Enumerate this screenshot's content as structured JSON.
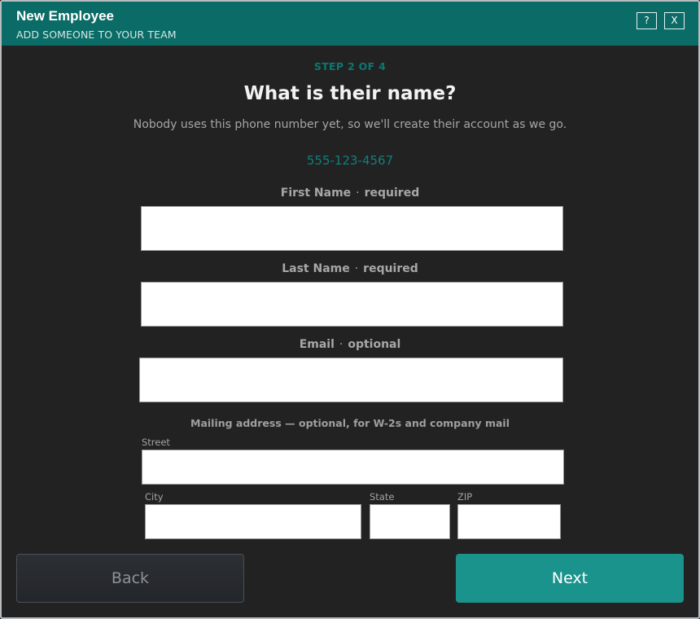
{
  "window": {
    "title": "New Employee",
    "subtitle": "ADD SOMEONE TO YOUR TEAM",
    "help_label": "?",
    "close_label": "X"
  },
  "step": {
    "text": "STEP 2 OF 4"
  },
  "heading": "What is their name?",
  "description": "Nobody uses this phone number yet, so we'll create their account as we go.",
  "phone_number": "555-123-4567",
  "fields": {
    "first_name": {
      "label": "First Name",
      "separator": "·",
      "qualifier": "required",
      "value": ""
    },
    "last_name": {
      "label": "Last Name",
      "separator": "·",
      "qualifier": "required",
      "value": ""
    },
    "email": {
      "label": "Email",
      "separator": "·",
      "qualifier": "optional",
      "value": ""
    }
  },
  "address": {
    "section_label": "Mailing address — optional, for W-2s and company mail",
    "street_label": "Street",
    "city_label": "City",
    "state_label": "State",
    "zip_label": "ZIP",
    "street_value": "",
    "city_value": "",
    "state_value": "",
    "zip_value": ""
  },
  "buttons": {
    "back": "Back",
    "next": "Next"
  },
  "colors": {
    "accent": "#0b6b66",
    "next_button": "#1a938c",
    "background": "#222222"
  }
}
